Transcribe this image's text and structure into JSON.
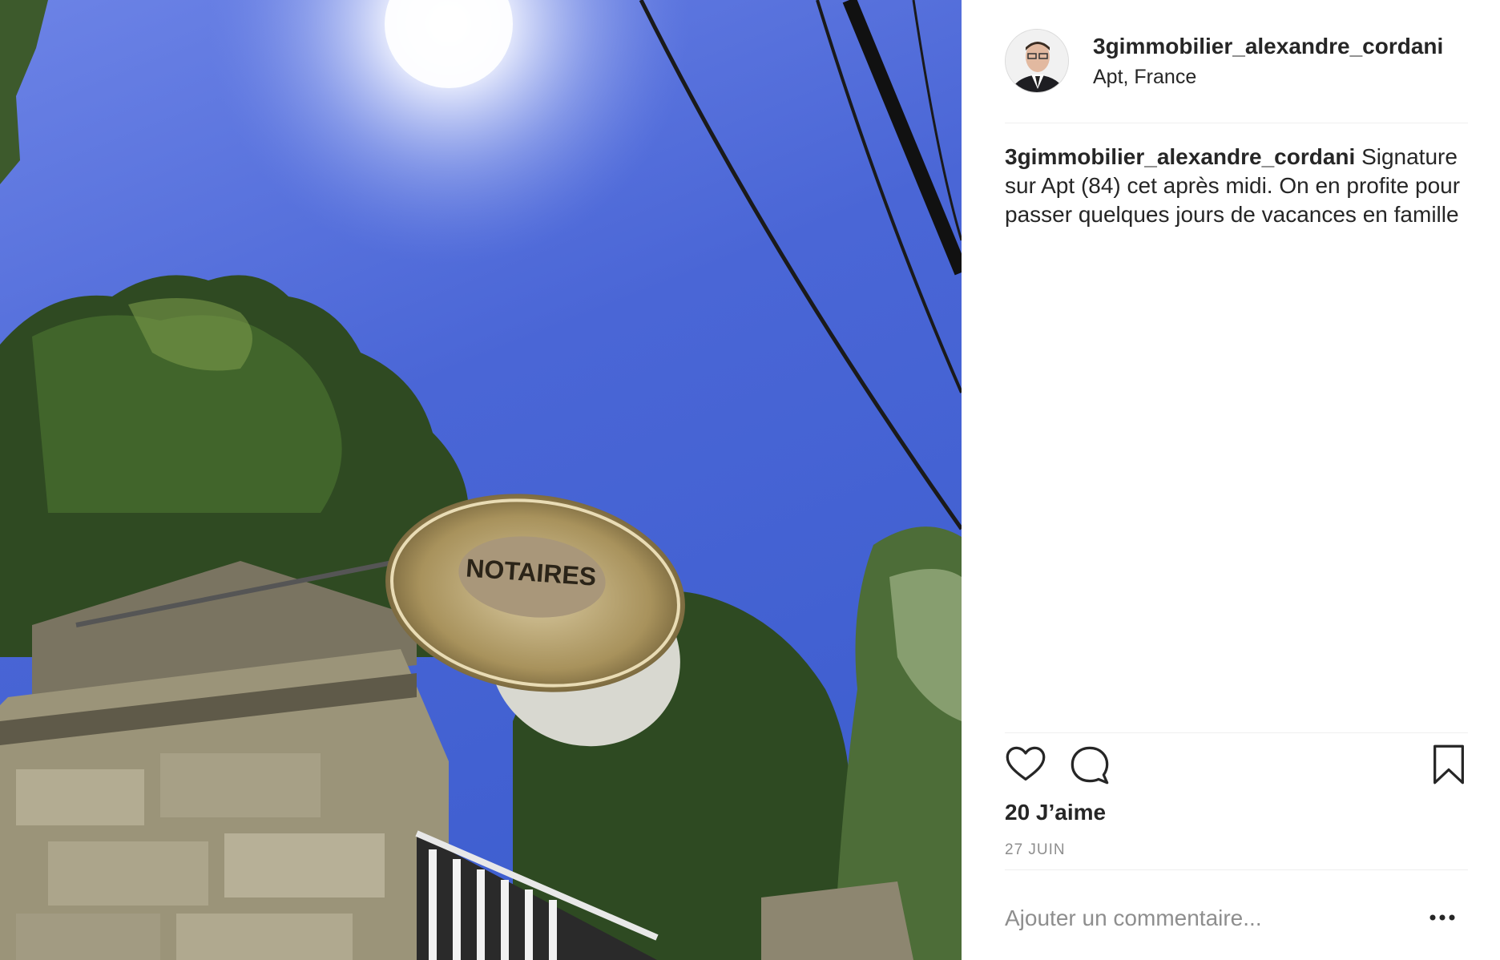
{
  "photo": {
    "sign_text": "NOTAIRES",
    "alt_icon": "photo"
  },
  "post": {
    "username": "3gimmobilier_alexandre_cordani",
    "location": "Apt, France",
    "caption_user": "3gimmobilier_alexandre_cordani",
    "caption_text": "Signature sur Apt (84) cet après midi. On en profite pour passer quelques jours de vacances en famille",
    "likes": "20 J’aime",
    "date": "27 JUIN"
  },
  "actions": {
    "like_icon": "heart-icon",
    "comment_icon": "comment-icon",
    "save_icon": "bookmark-icon",
    "more_icon": "more-options-icon"
  },
  "comment": {
    "placeholder": "Ajouter un commentaire..."
  },
  "colors": {
    "sky": "#4a67d4",
    "text": "#262626",
    "muted": "#8e8e8e",
    "divider": "#efefef"
  }
}
